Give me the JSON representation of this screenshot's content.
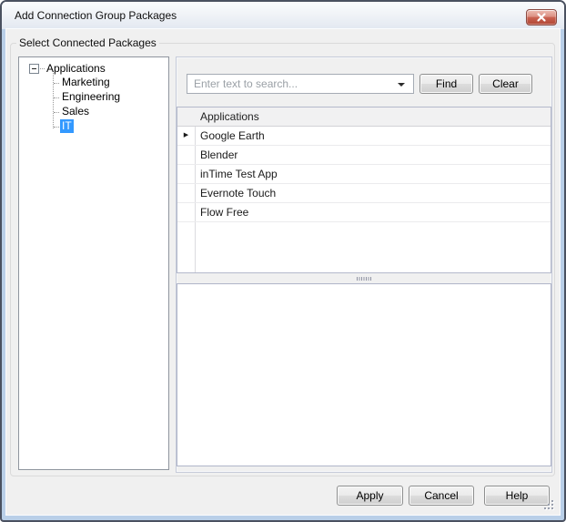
{
  "window": {
    "title": "Add Connection Group Packages",
    "icons": {
      "close": "close-icon",
      "dropdown": "chevron-down-icon",
      "current_row": "right-arrow-icon",
      "tree_expander": "minus-expander-icon",
      "resize": "resize-grip-icon"
    }
  },
  "group_box": {
    "label": "Select Connected Packages"
  },
  "tree": {
    "root": {
      "label": "Applications",
      "expanded": true
    },
    "items": [
      {
        "label": "Marketing",
        "selected": false
      },
      {
        "label": "Engineering",
        "selected": false
      },
      {
        "label": "Sales",
        "selected": false
      },
      {
        "label": "IT",
        "selected": true
      }
    ]
  },
  "search": {
    "placeholder": "Enter text to search...",
    "value": "",
    "find_label": "Find",
    "clear_label": "Clear"
  },
  "table": {
    "header": "Applications",
    "rows": [
      {
        "label": "Google Earth",
        "indicator": "▶"
      },
      {
        "label": "Blender",
        "indicator": ""
      },
      {
        "label": "inTime Test App",
        "indicator": ""
      },
      {
        "label": "Evernote Touch",
        "indicator": ""
      },
      {
        "label": "Flow Free",
        "indicator": ""
      }
    ]
  },
  "footer": {
    "apply_label": "Apply",
    "cancel_label": "Cancel",
    "help_label": "Help"
  },
  "colors": {
    "selection_blue": "#3399ff",
    "close_button_red": "#c05341",
    "frame_blue": "#b9cfe8",
    "client_gray": "#f0f0f0"
  }
}
